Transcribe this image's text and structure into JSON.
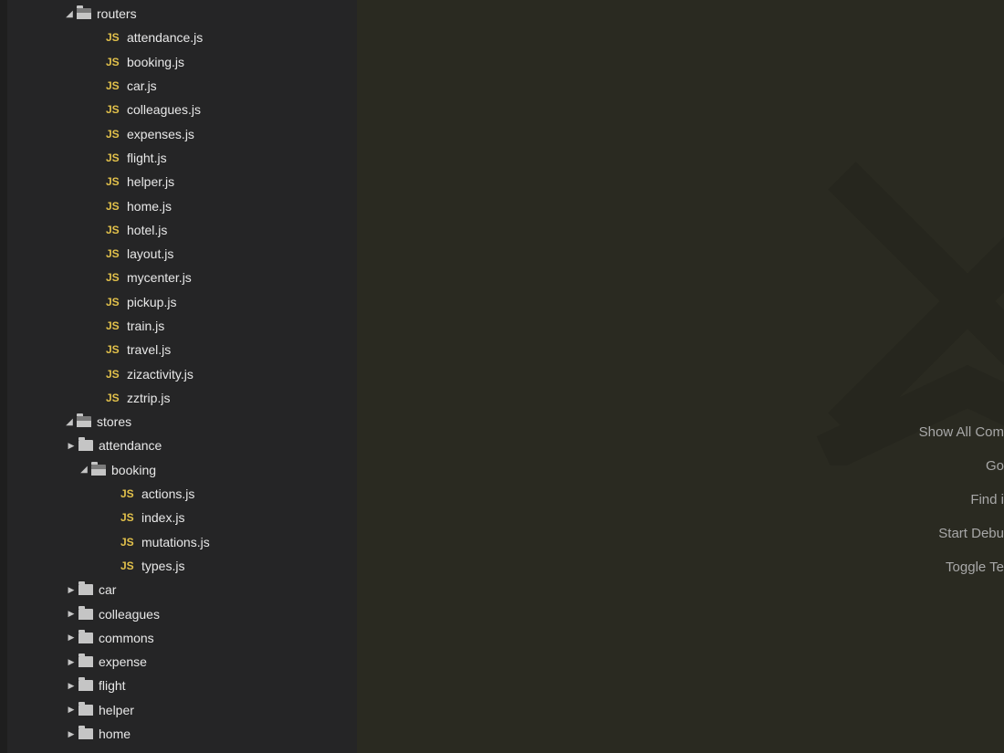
{
  "tree": [
    {
      "depth": 0,
      "kind": "folder",
      "state": "open",
      "label": "routers"
    },
    {
      "depth": 1,
      "kind": "js",
      "label": "attendance.js"
    },
    {
      "depth": 1,
      "kind": "js",
      "label": "booking.js"
    },
    {
      "depth": 1,
      "kind": "js",
      "label": "car.js"
    },
    {
      "depth": 1,
      "kind": "js",
      "label": "colleagues.js"
    },
    {
      "depth": 1,
      "kind": "js",
      "label": "expenses.js"
    },
    {
      "depth": 1,
      "kind": "js",
      "label": "flight.js"
    },
    {
      "depth": 1,
      "kind": "js",
      "label": "helper.js"
    },
    {
      "depth": 1,
      "kind": "js",
      "label": "home.js"
    },
    {
      "depth": 1,
      "kind": "js",
      "label": "hotel.js"
    },
    {
      "depth": 1,
      "kind": "js",
      "label": "layout.js"
    },
    {
      "depth": 1,
      "kind": "js",
      "label": "mycenter.js"
    },
    {
      "depth": 1,
      "kind": "js",
      "label": "pickup.js"
    },
    {
      "depth": 1,
      "kind": "js",
      "label": "train.js"
    },
    {
      "depth": 1,
      "kind": "js",
      "label": "travel.js"
    },
    {
      "depth": 1,
      "kind": "js",
      "label": "zizactivity.js"
    },
    {
      "depth": 1,
      "kind": "js",
      "label": "zztrip.js"
    },
    {
      "depth": 0,
      "kind": "folder",
      "state": "open",
      "label": "stores"
    },
    {
      "depth": 1,
      "kind": "folder",
      "state": "closed",
      "label": "attendance"
    },
    {
      "depth": 1,
      "kind": "folder",
      "state": "open",
      "label": "booking"
    },
    {
      "depth": 2,
      "kind": "js",
      "label": "actions.js"
    },
    {
      "depth": 2,
      "kind": "js",
      "label": "index.js"
    },
    {
      "depth": 2,
      "kind": "js",
      "label": "mutations.js"
    },
    {
      "depth": 2,
      "kind": "js",
      "label": "types.js"
    },
    {
      "depth": 1,
      "kind": "folder",
      "state": "closed",
      "label": "car"
    },
    {
      "depth": 1,
      "kind": "folder",
      "state": "closed",
      "label": "colleagues"
    },
    {
      "depth": 1,
      "kind": "folder",
      "state": "closed",
      "label": "commons"
    },
    {
      "depth": 1,
      "kind": "folder",
      "state": "closed",
      "label": "expense"
    },
    {
      "depth": 1,
      "kind": "folder",
      "state": "closed",
      "label": "flight"
    },
    {
      "depth": 1,
      "kind": "folder",
      "state": "closed",
      "label": "helper"
    },
    {
      "depth": 1,
      "kind": "folder",
      "state": "closed",
      "label": "home"
    }
  ],
  "indent": {
    "base": 62,
    "step": 16,
    "fileExtra": 30,
    "closedFolderPre": 14
  },
  "jsBadge": "JS",
  "commands": [
    "Show All Com",
    "Go ",
    "Find i",
    "Start Debu",
    "Toggle Te"
  ]
}
